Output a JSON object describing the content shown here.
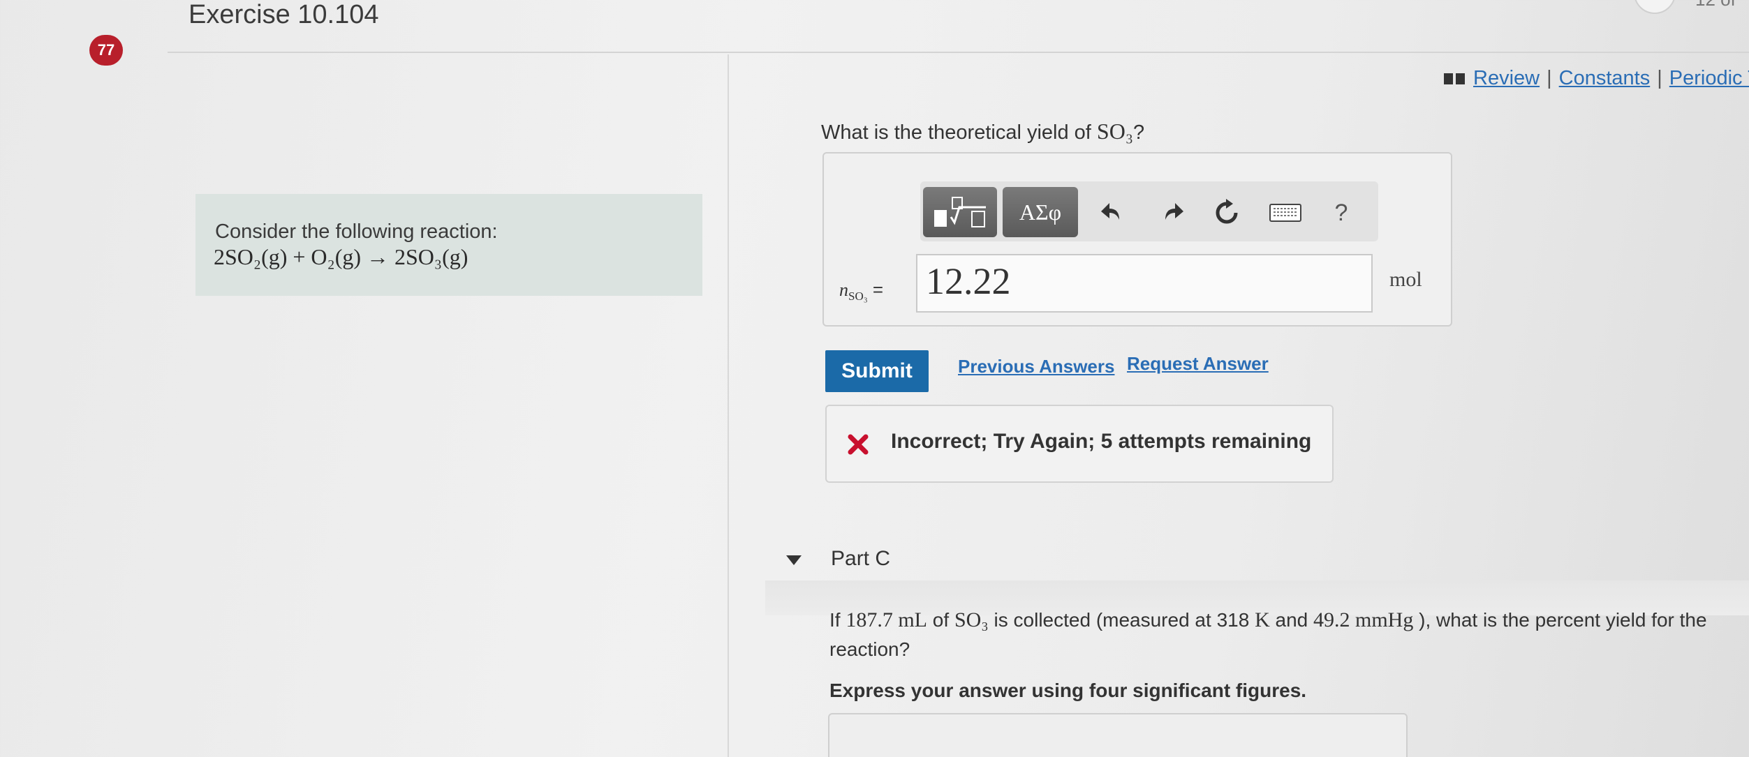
{
  "exercise": {
    "title": "Exercise 10.104",
    "badge": "77"
  },
  "top_links": {
    "review": "Review",
    "constants": "Constants",
    "periodic": "Periodic T",
    "separator": "|"
  },
  "reaction": {
    "intro": "Consider the following reaction:",
    "equation": "2SO₂(g) + O₂(g) → 2SO₃(g)"
  },
  "partB": {
    "question_prefix": "What is the theoretical yield of ",
    "question_formula": "SO₃",
    "question_suffix": "?",
    "toolbar": {
      "symbols_label": "ΑΣφ",
      "help_label": "?"
    },
    "answer_symbol": "n",
    "answer_subscript": "SO₃",
    "answer_equals": "=",
    "answer_value": "12.22",
    "unit": "mol",
    "submit_label": "Submit",
    "previous_answers_label": "Previous Answers",
    "request_answer_label": "Request Answer",
    "feedback": "Incorrect; Try Again; 5 attempts remaining"
  },
  "partC": {
    "label": "Part C",
    "q1": "If ",
    "volume": "187.7 mL",
    "q2": " of ",
    "formula": "SO₃",
    "q3": " is collected (measured at 318 ",
    "temp_unit": "K",
    "q4": " and ",
    "pressure": "49.2 mmHg",
    "q5": " ), what is the percent yield for the reaction?",
    "instruction": "Express your answer using four significant figures."
  },
  "corner": {
    "text": "12 of"
  },
  "colors": {
    "link": "#2a6db5",
    "submit": "#1b6aa8",
    "badge": "#b81f2b",
    "error": "#c8102e"
  }
}
